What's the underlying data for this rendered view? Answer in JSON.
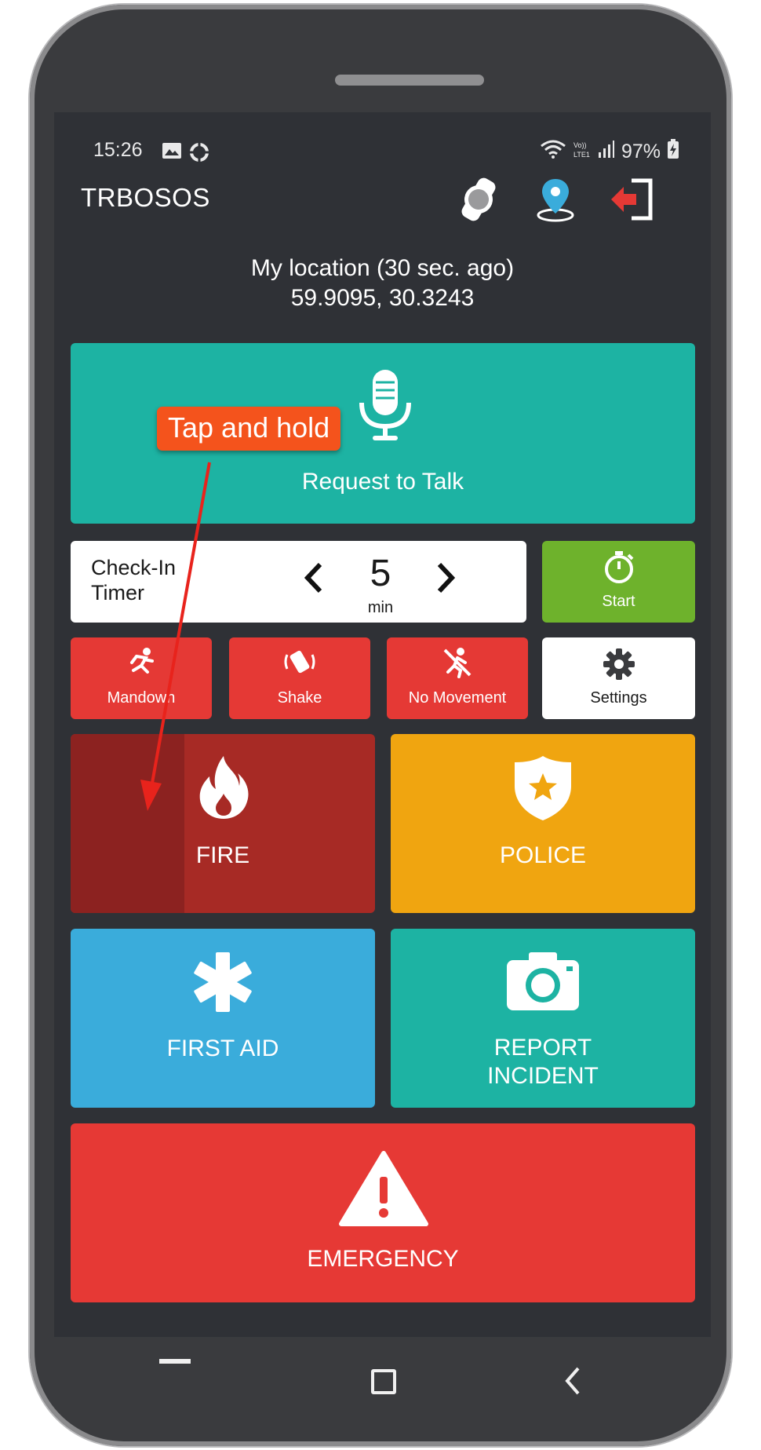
{
  "status_bar": {
    "time": "15:26",
    "battery": "97%"
  },
  "app_bar": {
    "title": "TRBOSOS"
  },
  "location": {
    "label": "My location (30 sec. ago)",
    "coords": "59.9095, 30.3243"
  },
  "talk": {
    "label": "Request to Talk"
  },
  "annotation": {
    "text": "Tap and hold"
  },
  "timer": {
    "label_line1": "Check-In",
    "label_line2": "Timer",
    "value": "5",
    "unit": "min",
    "start_label": "Start"
  },
  "modes": [
    {
      "label": "Mandown",
      "icon": "falling-person-icon"
    },
    {
      "label": "Shake",
      "icon": "shake-phone-icon"
    },
    {
      "label": "No Movement",
      "icon": "no-movement-icon"
    },
    {
      "label": "Settings",
      "icon": "gear-icon"
    }
  ],
  "services": [
    {
      "label": "FIRE",
      "icon": "flame-icon",
      "color": "#a72a25"
    },
    {
      "label": "POLICE",
      "icon": "police-badge-icon",
      "color": "#f0a510"
    },
    {
      "label": "FIRST AID",
      "icon": "asterisk-icon",
      "color": "#3aacdb"
    },
    {
      "label_line1": "REPORT",
      "label_line2": "INCIDENT",
      "icon": "camera-icon",
      "color": "#1db3a3"
    }
  ],
  "emergency": {
    "label": "EMERGENCY",
    "icon": "warning-icon",
    "color": "#e63935"
  },
  "colors": {
    "screen_bg": "#2f3136",
    "red": "#e53935",
    "green": "#6eb22c",
    "teal": "#1db3a3",
    "annotation": "#f4531c"
  }
}
